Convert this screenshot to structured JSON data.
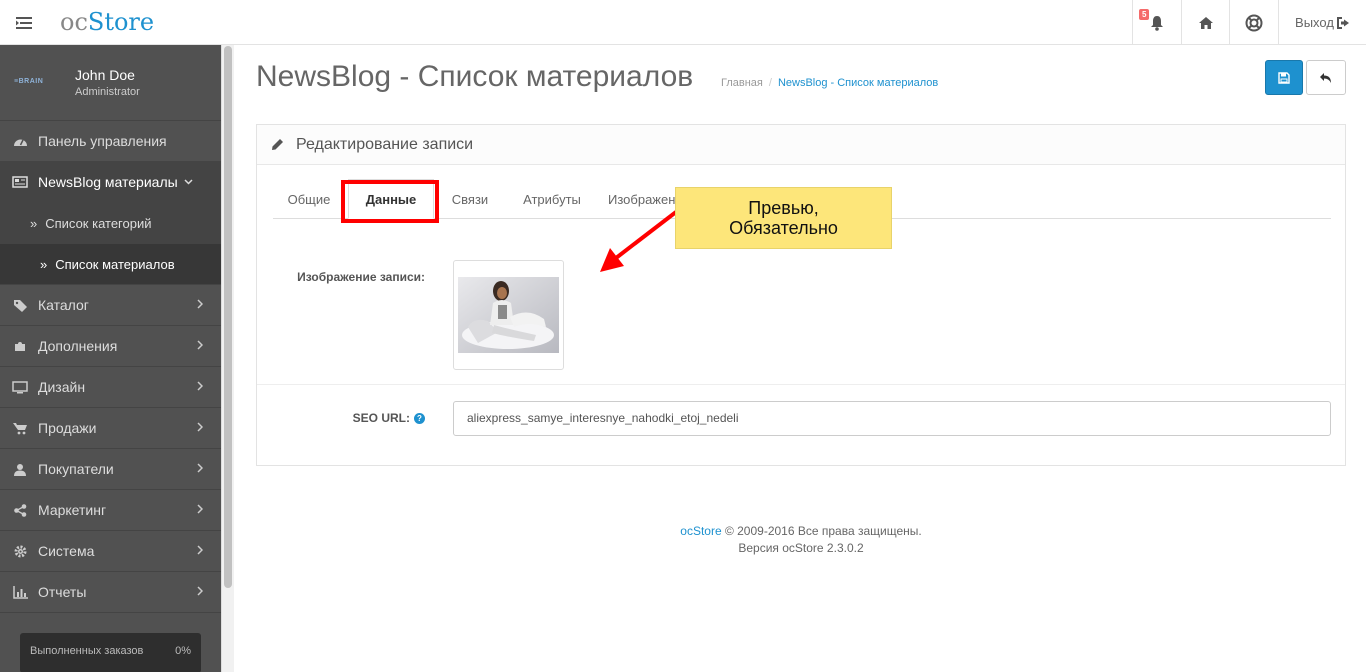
{
  "header": {
    "logo_oc": "oc",
    "logo_store": "Store",
    "notification_count": "5",
    "logout_label": "Выход"
  },
  "sidebar": {
    "user_name": "John Doe",
    "user_role": "Administrator",
    "avatar_text": "≡BRAIN",
    "items": [
      {
        "label": "Панель управления",
        "icon": "dashboard-icon"
      },
      {
        "label": "NewsBlog материалы",
        "icon": "newspaper-icon"
      },
      {
        "label": "Каталог",
        "icon": "tags-icon"
      },
      {
        "label": "Дополнения",
        "icon": "puzzle-icon"
      },
      {
        "label": "Дизайн",
        "icon": "monitor-icon"
      },
      {
        "label": "Продажи",
        "icon": "cart-icon"
      },
      {
        "label": "Покупатели",
        "icon": "user-icon"
      },
      {
        "label": "Маркетинг",
        "icon": "share-icon"
      },
      {
        "label": "Система",
        "icon": "cog-icon"
      },
      {
        "label": "Отчеты",
        "icon": "bar-chart-icon"
      }
    ],
    "sub_items": [
      {
        "label": "Список категорий"
      },
      {
        "label": "Список материалов"
      }
    ],
    "progress": {
      "label": "Выполненных заказов",
      "value": "0%"
    }
  },
  "page": {
    "title": "NewsBlog - Список материалов",
    "breadcrumb": [
      "Главная",
      "NewsBlog - Список материалов"
    ]
  },
  "panel": {
    "heading": "Редактирование записи",
    "tabs": [
      "Общие",
      "Данные",
      "Связи",
      "Атрибуты",
      "Изображен"
    ],
    "active_tab": "Данные",
    "image_label": "Изображение записи:",
    "seo_label": "SEO URL:",
    "seo_help": "?",
    "seo_value": "aliexpress_samye_interesnye_nahodki_etoj_nedeli"
  },
  "callout": {
    "line1": "Превью,",
    "line2": "Обязательно"
  },
  "footer": {
    "brand": "ocStore",
    "copyright": " © 2009-2016 Все права защищены.",
    "version": "Версия ocStore 2.3.0.2"
  },
  "colors": {
    "accent": "#1e91cf",
    "sidebar_bg": "#515151",
    "highlight": "#ff0000",
    "callout_bg": "#fde67a"
  }
}
